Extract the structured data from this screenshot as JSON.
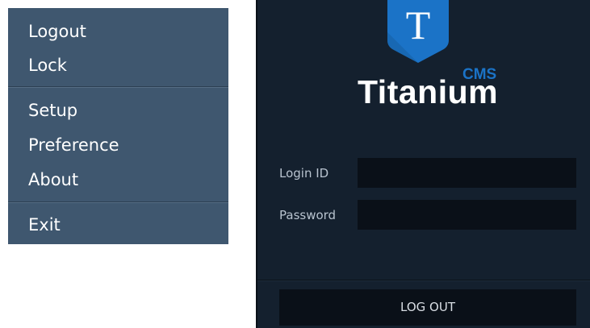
{
  "menu": {
    "items": [
      {
        "label": "Logout"
      },
      {
        "label": "Lock"
      },
      {
        "label": "Setup"
      },
      {
        "label": "Preference"
      },
      {
        "label": "About"
      },
      {
        "label": "Exit"
      }
    ]
  },
  "login": {
    "logo_letter": "T",
    "logo_word": "Titanium",
    "logo_suffix": "CMS",
    "login_id_label": "Login ID",
    "login_id_value": "",
    "password_label": "Password",
    "password_value": "",
    "logout_label": "LOG OUT"
  },
  "colors": {
    "menu_bg": "#3f576f",
    "panel_bg": "#14202e",
    "input_bg": "#0a1018",
    "brand_blue": "#1b73c7"
  },
  "icons": {
    "logo": "titanium-shield-logo-icon"
  }
}
